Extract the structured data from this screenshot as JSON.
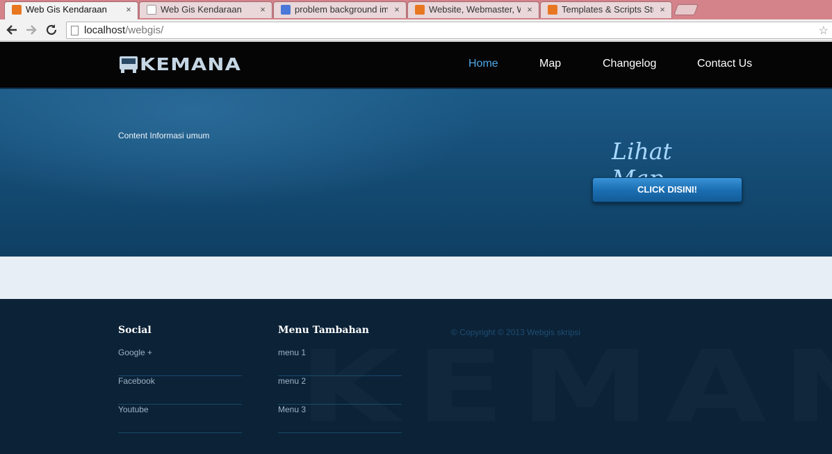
{
  "browser": {
    "tabs": [
      {
        "label": "Web Gis Kendaraan",
        "favicon": "xampp-icon",
        "active": true
      },
      {
        "label": "Web Gis Kendaraan",
        "favicon": "page-icon",
        "active": false
      },
      {
        "label": "problem background ima",
        "favicon": "google-icon",
        "active": false
      },
      {
        "label": "Website, Webmaster, Web",
        "favicon": "xampp-icon",
        "active": false
      },
      {
        "label": "Templates & Scripts Stuff",
        "favicon": "xampp-icon",
        "active": false
      }
    ],
    "tab_close_glyph": "×",
    "url_host": "localhost",
    "url_path": "/webgis/"
  },
  "header": {
    "logo_text": "KEMANA",
    "nav": [
      {
        "label": "Home",
        "active": true
      },
      {
        "label": "Map",
        "active": false
      },
      {
        "label": "Changelog",
        "active": false
      },
      {
        "label": "Contact Us",
        "active": false
      }
    ]
  },
  "hero": {
    "info_text": "Content Informasi umum",
    "map_heading": "Lihat Map",
    "cta_label": "CLICK DISINI!"
  },
  "footer": {
    "social_title": "Social",
    "social_links": [
      "Google +",
      "Facebook",
      "Youtube"
    ],
    "menu_title": "Menu Tambahan",
    "menu_links": [
      "menu 1",
      "menu 2",
      "Menu 3"
    ],
    "copyright": "© Copyright © 2013 Webgis skripsi",
    "watermark": "KEMANA"
  },
  "colors": {
    "tabstrip": "#d4838a",
    "header_bg": "#050505",
    "nav_active": "#4fa8e8",
    "hero_bg": "#154d76",
    "cta": "#1b6fb3",
    "footer_bg": "#0b2237"
  }
}
